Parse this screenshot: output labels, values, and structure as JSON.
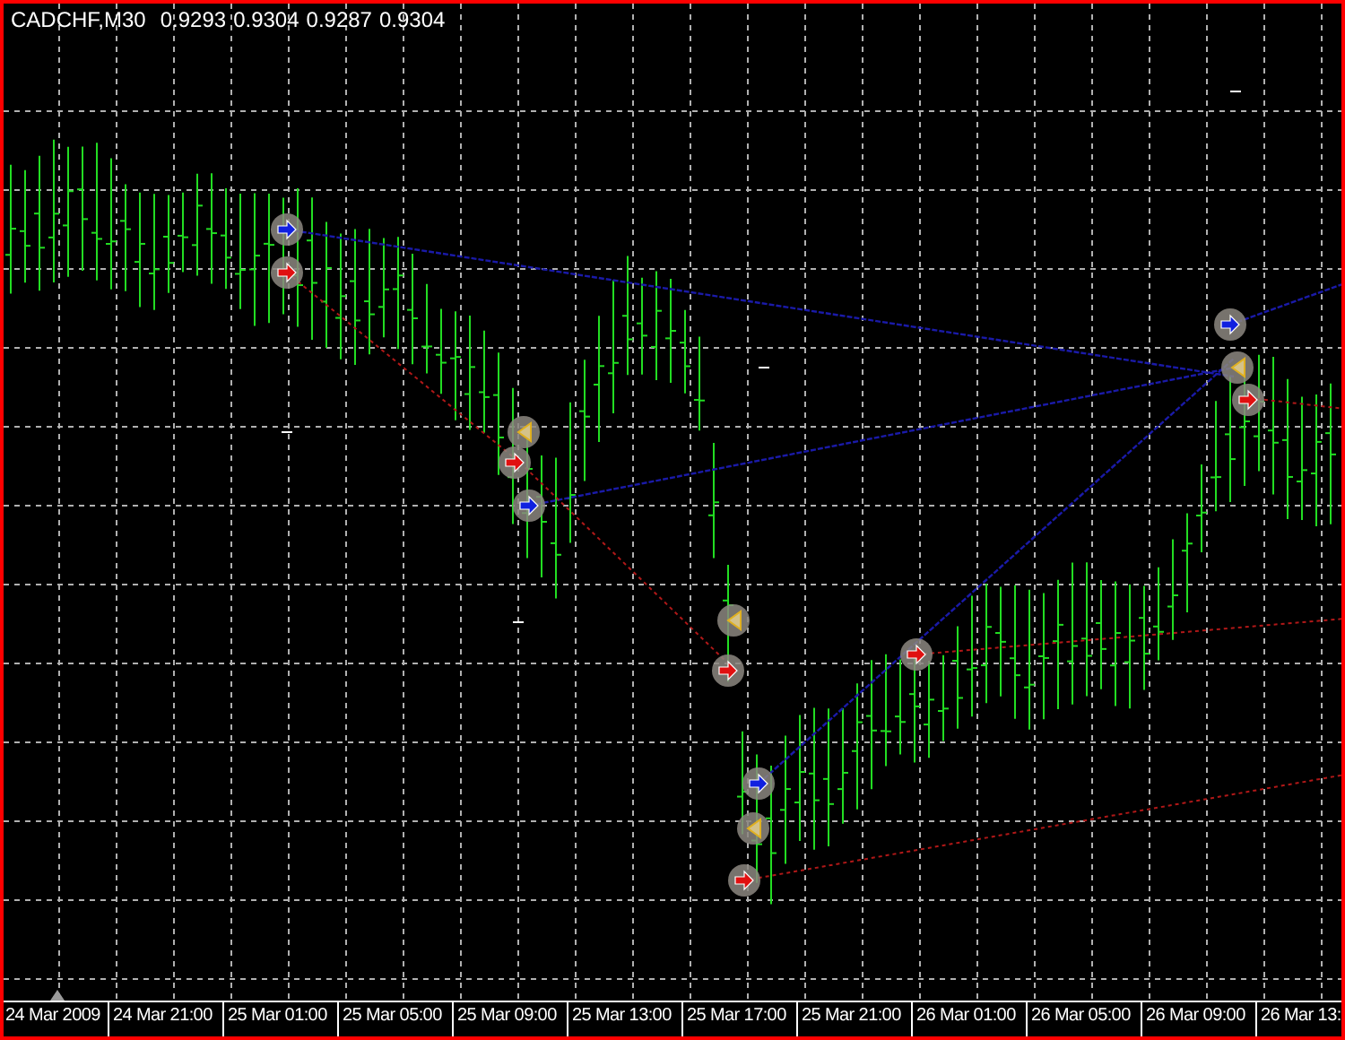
{
  "chart": {
    "symbol": "CADCHF,M30",
    "quotes": [
      "0.9293",
      "0.9304",
      "0.9287",
      "0.9304"
    ]
  },
  "time_axis": {
    "labels": [
      "24 Mar 2009",
      "24 Mar 21:00",
      "25 Mar 01:00",
      "25 Mar 05:00",
      "25 Mar 09:00",
      "25 Mar 13:00",
      "25 Mar 17:00",
      "25 Mar 21:00",
      "26 Mar 01:00",
      "26 Mar 05:00",
      "26 Mar 09:00",
      "26 Mar 13:"
    ]
  }
}
